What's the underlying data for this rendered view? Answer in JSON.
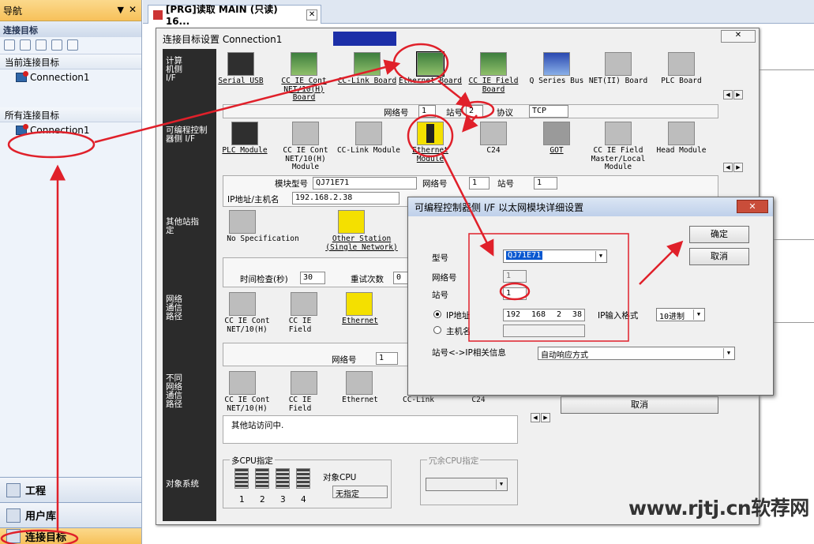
{
  "nav": {
    "title": "导航",
    "section_title": "连接目标",
    "current_group": "当前连接目标",
    "current_item": "Connection1",
    "all_group": "所有连接目标",
    "all_item": "Connection1",
    "bottom_tabs": [
      "工程",
      "用户库",
      "连接目标"
    ]
  },
  "tab": {
    "label": "[PRG]读取 MAIN (只读) 16..."
  },
  "dialog": {
    "title": "连接目标设置 Connection1",
    "pc_side_label": "计算机侧 I/F",
    "pc_items": [
      "Serial USB",
      "CC IE Cont NET/10(H) Board",
      "CC-Link Board",
      "Ethernet Board",
      "CC IE Field Board",
      "Q Series Bus",
      "NET(II) Board",
      "PLC Board"
    ],
    "pc_strip": {
      "network_label": "网络号",
      "network_value": "1",
      "station_label": "站号",
      "station_value": "2",
      "protocol_label": "协议",
      "protocol_value": "TCP"
    },
    "plc_side_label": "可编程控制器侧 I/F",
    "plc_items": [
      "PLC Module",
      "CC IE Cont NET/10(H) Module",
      "CC-Link Module",
      "Ethernet Module",
      "C24",
      "GOT",
      "CC IE Field Master/Local Module",
      "Head Module"
    ],
    "plc_strip": {
      "model_label": "模块型号",
      "model_value": "QJ71E71",
      "network_label": "网络号",
      "network_value": "1",
      "station_label": "站号",
      "station_value": "1",
      "ip_label": "IP地址/主机名",
      "ip_value": "192.168.2.38"
    },
    "other_label": "其他站指定",
    "other_items": [
      "No Specification",
      "Other Station (Single Network)"
    ],
    "time_check_label": "时间检查(秒)",
    "time_check_value": "30",
    "retry_label": "重试次数",
    "retry_value": "0",
    "route_label": "网络通信路径",
    "route_items": [
      "CC IE Cont NET/10(H)",
      "CC IE Field",
      "Ethernet"
    ],
    "route_network_label": "网络号",
    "route_network_value": "1",
    "diff_label": "不同网络通信路径",
    "diff_items": [
      "CC IE Cont NET/10(H)",
      "CC IE Field",
      "Ethernet",
      "CC-Link",
      "C24"
    ],
    "status_text": "其他站访问中.",
    "target_label": "对象系统",
    "multicpu_label": "多CPU指定",
    "cpu_numbers": [
      "1",
      "2",
      "3",
      "4"
    ],
    "target_cpu_label": "对象CPU",
    "target_cpu_value": "无指定",
    "redundant_label": "冗余CPU指定",
    "cancel_label": "取消"
  },
  "subdialog": {
    "title": "可编程控制器侧 I/F 以太网模块详细设置",
    "ok_label": "确定",
    "cancel_label": "取消",
    "model_label": "型号",
    "model_value": "QJ71E71",
    "network_label": "网络号",
    "network_value": "1",
    "station_label": "站号",
    "station_value": "1",
    "ip_radio_label": "IP地址",
    "ip_parts": [
      "192",
      "168",
      "2",
      "38"
    ],
    "ip_format_label": "IP输入格式",
    "ip_format_value": "10进制",
    "host_radio_label": "主机名",
    "mapping_label": "站号<->IP相关信息",
    "mapping_value": "自动响应方式"
  },
  "watermark": "www.rjtj.cn软荐网",
  "colors": {
    "annotation": "#e0202a",
    "highlight_blue": "#0a58d0"
  }
}
